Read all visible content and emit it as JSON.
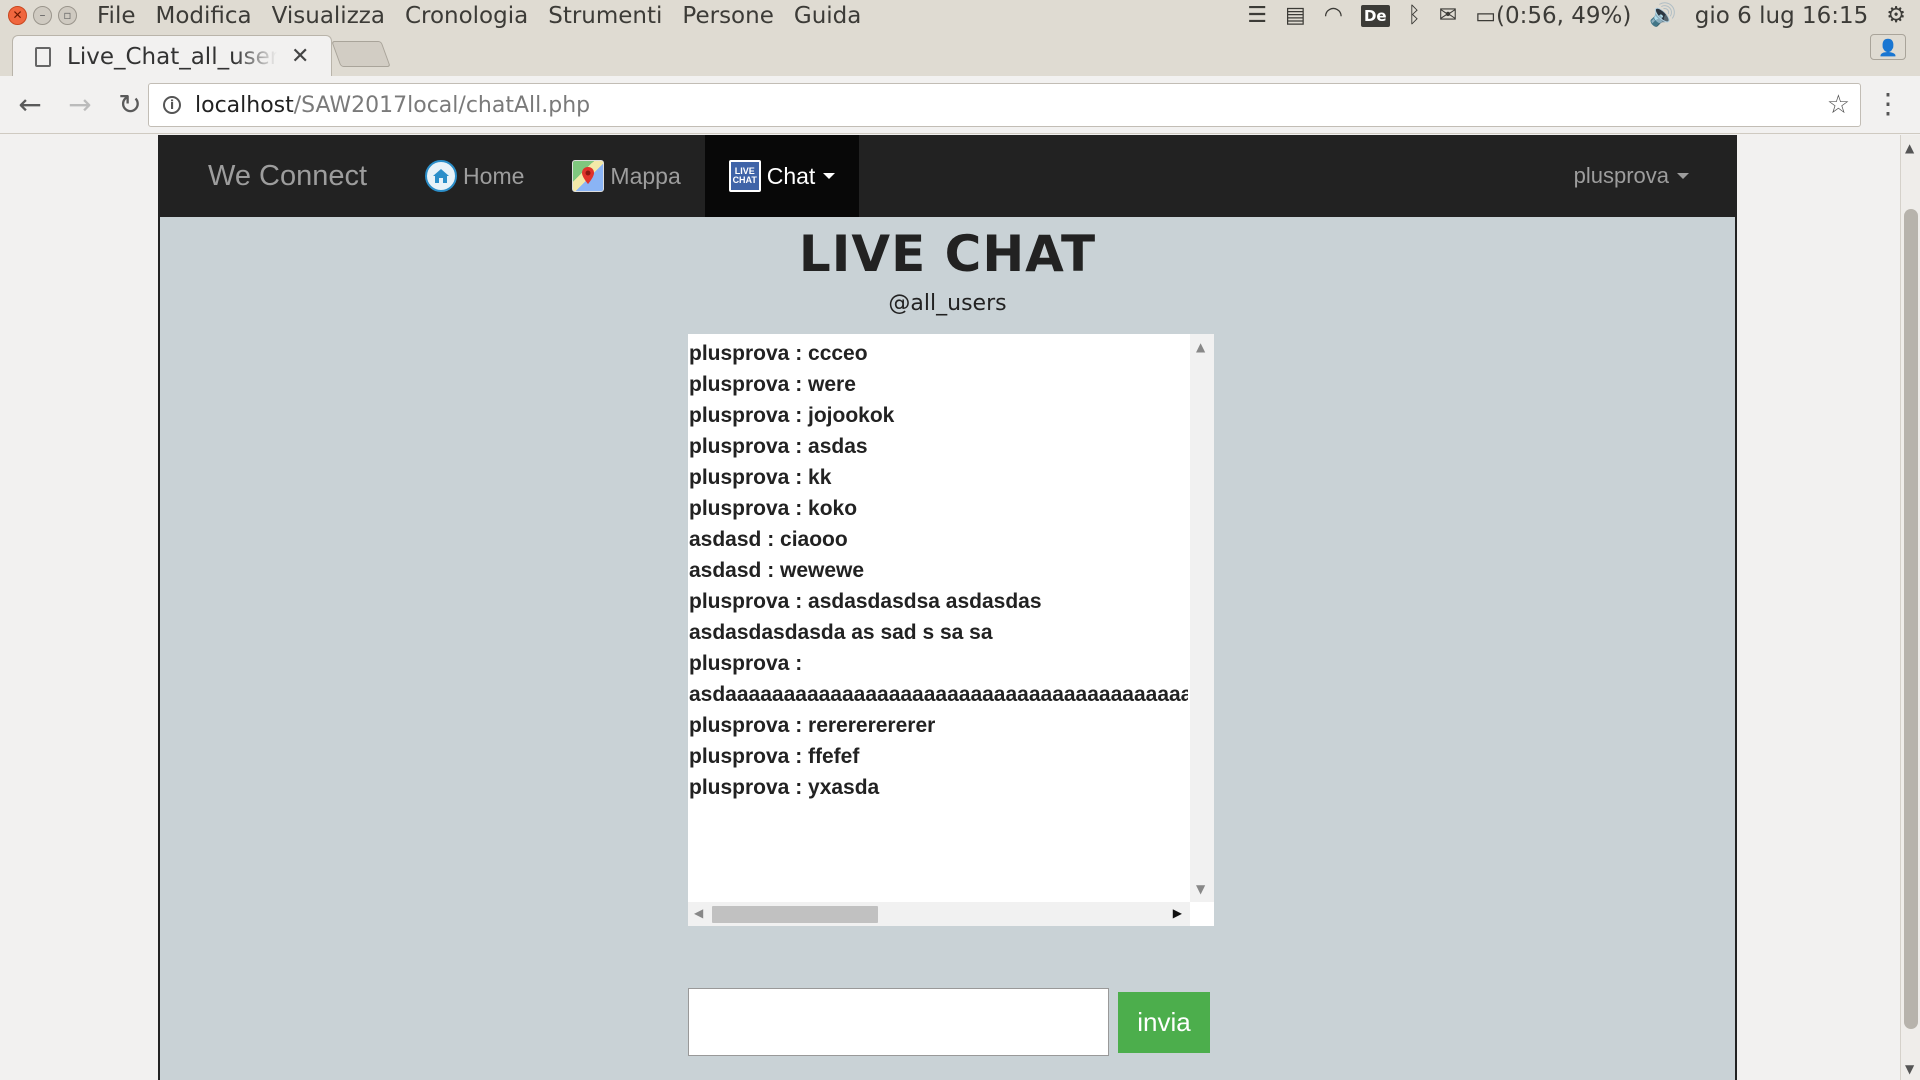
{
  "os": {
    "menu": [
      "File",
      "Modifica",
      "Visualizza",
      "Cronologia",
      "Strumenti",
      "Persone",
      "Guida"
    ],
    "battery": "(0:56, 49%)",
    "clock": "gio  6 lug 16:15",
    "de_badge": "De"
  },
  "browser": {
    "tab_title": "Live_Chat_all_users",
    "url_host": "localhost",
    "url_path": "/SAW2017local/chatAll.php"
  },
  "navbar": {
    "brand": "We Connect",
    "home": "Home",
    "map": "Mappa",
    "chat": "Chat",
    "chat_icon_text": "LIVE CHAT",
    "user": "plusprova"
  },
  "page": {
    "title": "LIVE CHAT",
    "subtitle": "@all_users"
  },
  "chat": {
    "messages": [
      "plusprova : ccceo",
      "plusprova : were",
      "plusprova : jojookok",
      "plusprova : asdas",
      "plusprova : kk",
      "plusprova : koko",
      "asdasd : ciaooo",
      "asdasd : wewewe",
      "plusprova : asdasdasdsa asdasdas",
      "asdasdasdasda as sad s sa sa",
      "plusprova :",
      "asdaaaaaaaaaaaaaaaaaaaaaaaaaaaaaaaaaaaaaaaaaa",
      "plusprova : rerererererer",
      "plusprova : ffefef",
      "plusprova : yxasda"
    ],
    "input_value": "",
    "send_label": "invia"
  },
  "colors": {
    "navbar_bg": "#222222",
    "page_bg": "#c9d2d6",
    "send_button": "#4cae4c"
  }
}
